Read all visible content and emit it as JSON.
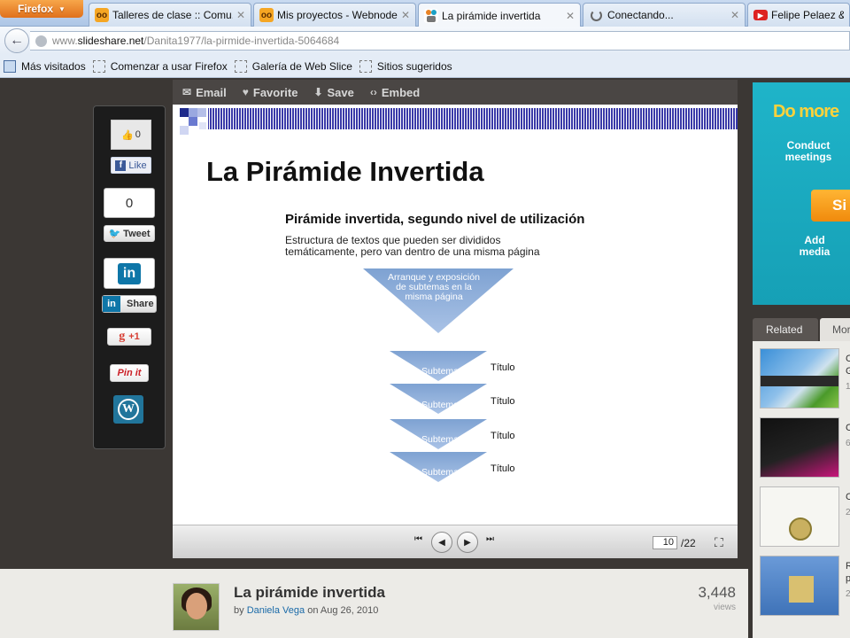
{
  "browser": {
    "firefox_button": "Firefox",
    "tabs": [
      {
        "label": "Talleres de clase :: Comu..."
      },
      {
        "label": "Mis proyectos - Webnode"
      },
      {
        "label": "La pirámide invertida"
      },
      {
        "label": "Conectando..."
      },
      {
        "label": "Felipe Pelaez & M"
      }
    ],
    "url_prefix": "www.",
    "url_host": "slideshare.net",
    "url_path": "/Danita1977/la-pirmide-invertida-5064684",
    "bookmarks": [
      "Más visitados",
      "Comenzar a usar Firefox",
      "Galería de Web Slice",
      "Sitios sugeridos"
    ]
  },
  "share": {
    "fb_count": "0",
    "fb_like": "Like",
    "tweet_count": "0",
    "tweet_label": "Tweet",
    "linkedin_share": "Share",
    "gplus_label": "+1",
    "pinit_label": "Pin it"
  },
  "player": {
    "tools": [
      "Email",
      "Favorite",
      "Save",
      "Embed"
    ],
    "current_page": "10",
    "total_pages": "/22"
  },
  "slide": {
    "title": "La Pirámide Invertida",
    "subtitle": "Pirámide invertida, segundo nivel de utilización",
    "description": "Estructura de textos que pueden ser divididos temáticamente, pero van dentro de una misma página",
    "top_triangle": "Arranque y exposición de subtemas en la misma página",
    "subtema_label": "Subtema",
    "titulo_label": "Título"
  },
  "document": {
    "title": "La pirámide invertida",
    "by": "by",
    "author": "Daniela Vega",
    "on": "on",
    "date": "Aug 26, 2010",
    "views_count": "3,448",
    "views_label": "views"
  },
  "ad": {
    "headline": "Do more",
    "line1": "Conduct meetings",
    "button": "Si",
    "line2": "Add media"
  },
  "related": {
    "tabs": [
      "Related",
      "Mor"
    ],
    "items": [
      {
        "letter": "C",
        "line2": "G",
        "count": "1"
      },
      {
        "letter": "C",
        "count": "6"
      },
      {
        "letter": "C",
        "count": "2"
      },
      {
        "letter": "R",
        "line2": "p",
        "count": "2"
      }
    ]
  },
  "colors": {
    "page_bg": "#3b3734",
    "link": "#1a6aa8",
    "ad_bg": "#1fb4c9",
    "triangle": "#86a8d4"
  }
}
